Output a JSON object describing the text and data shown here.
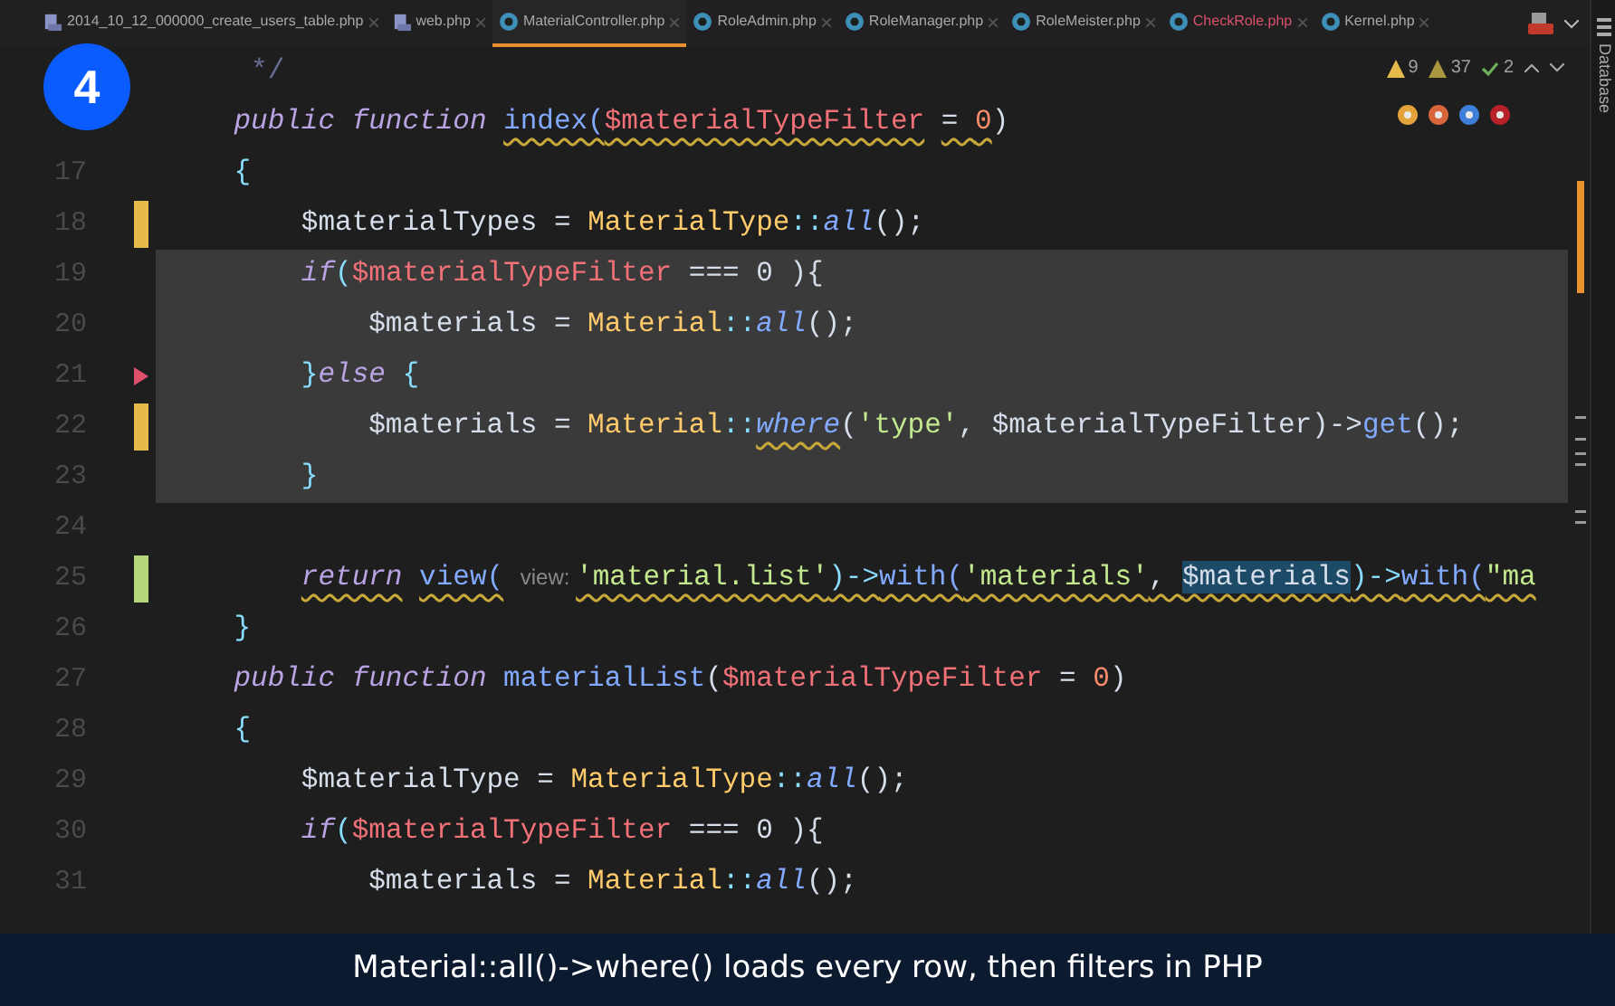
{
  "tabs": [
    {
      "label": "2014_10_12_000000_create_users_table.php",
      "kind": "database",
      "selected": false,
      "error": false
    },
    {
      "label": "web.php",
      "kind": "database",
      "selected": false,
      "error": false
    },
    {
      "label": "MaterialController.php",
      "kind": "class",
      "selected": true,
      "error": false
    },
    {
      "label": "RoleAdmin.php",
      "kind": "class",
      "selected": false,
      "error": false
    },
    {
      "label": "RoleManager.php",
      "kind": "class",
      "selected": false,
      "error": false
    },
    {
      "label": "RoleMeister.php",
      "kind": "class",
      "selected": false,
      "error": false
    },
    {
      "label": "CheckRole.php",
      "kind": "class",
      "selected": false,
      "error": true
    },
    {
      "label": "Kernel.php",
      "kind": "class",
      "selected": false,
      "error": false
    }
  ],
  "side_panel": {
    "label": "Database"
  },
  "step_badge": "4",
  "inspections": [
    {
      "kind": "warning",
      "count": "9"
    },
    {
      "kind": "weak",
      "count": "37"
    },
    {
      "kind": "typo",
      "count": "2"
    }
  ],
  "editor": {
    "lines": [
      {
        "selected": false,
        "tokens": [
          {
            "text": "     */",
            "kind": "comment"
          }
        ]
      },
      {
        "selected": false,
        "tokens": [
          {
            "text": "    public function ",
            "kind": "keyword"
          },
          {
            "text": "index(",
            "kind": "fn",
            "squiggle": true
          },
          {
            "text": "$materialTypeFilter",
            "kind": "param",
            "squiggle": true
          },
          {
            "text": " = ",
            "kind": "plain",
            "squiggle": true
          },
          {
            "text": "0",
            "kind": "number",
            "squiggle": true
          },
          {
            "text": ")",
            "kind": "plain",
            "squiggle": false
          }
        ]
      },
      {
        "number": "17",
        "selected": false,
        "tokens": [
          {
            "text": "    {",
            "kind": "punct"
          }
        ]
      },
      {
        "number": "18",
        "kind": "modified",
        "selected": false,
        "tokens": [
          {
            "text": "        $materialTypes = ",
            "kind": "plain"
          },
          {
            "text": "MaterialType",
            "kind": "class"
          },
          {
            "text": "::",
            "kind": "punct"
          },
          {
            "text": "all",
            "kind": "static"
          },
          {
            "text": "();",
            "kind": "plain"
          }
        ]
      },
      {
        "number": "19",
        "selected": true,
        "tokens": [
          {
            "text": "        if",
            "kind": "keyword"
          },
          {
            "text": "(",
            "kind": "punct"
          },
          {
            "text": "$materialTypeFilter",
            "kind": "param"
          },
          {
            "text": " === 0 ){",
            "kind": "plain"
          }
        ]
      },
      {
        "number": "20",
        "selected": true,
        "tokens": [
          {
            "text": "            $materials = ",
            "kind": "plain"
          },
          {
            "text": "Material",
            "kind": "class"
          },
          {
            "text": "::",
            "kind": "punct"
          },
          {
            "text": "all",
            "kind": "static"
          },
          {
            "text": "();",
            "kind": "plain"
          }
        ]
      },
      {
        "number": "21",
        "kind": "pointer",
        "selected": true,
        "tokens": [
          {
            "text": "        }",
            "kind": "punct"
          },
          {
            "text": "else",
            "kind": "keyword"
          },
          {
            "text": " {",
            "kind": "punct"
          }
        ]
      },
      {
        "number": "22",
        "kind": "modified",
        "selected": true,
        "tokens": [
          {
            "text": "            $materials = ",
            "kind": "plain"
          },
          {
            "text": "Material",
            "kind": "class"
          },
          {
            "text": "::",
            "kind": "punct"
          },
          {
            "text": "where",
            "kind": "static",
            "squiggle": true
          },
          {
            "text": "(",
            "kind": "plain",
            "squiggle": false
          },
          {
            "text": "'type'",
            "kind": "string"
          },
          {
            "text": ", $materialTypeFilter)->",
            "kind": "plain"
          },
          {
            "text": "get",
            "kind": "fn"
          },
          {
            "text": "();",
            "kind": "plain"
          }
        ]
      },
      {
        "number": "23",
        "selected": true,
        "tokens": [
          {
            "text": "        }",
            "kind": "punct"
          }
        ]
      },
      {
        "number": "24",
        "selected": false
      },
      {
        "number": "25",
        "kind": "added",
        "selected": false,
        "tokens": [
          {
            "text": "        return",
            "kind": "keyword",
            "squiggle": true
          },
          {
            "text": " view(",
            "kind": "fn",
            "squiggle": true
          },
          {
            "text": " view: ",
            "kind": "hint"
          },
          {
            "text": "'material.list'",
            "kind": "string",
            "squiggle": true
          },
          {
            "text": ")->",
            "kind": "punct",
            "squiggle": true
          },
          {
            "text": "with(",
            "kind": "fn",
            "squiggle": true
          },
          {
            "text": "'materials'",
            "kind": "string",
            "squiggle": true
          },
          {
            "text": ", ",
            "kind": "plain",
            "squiggle": true
          },
          {
            "text": "$materials",
            "kind": "usage",
            "squiggle": true
          },
          {
            "text": ")->",
            "kind": "punct",
            "squiggle": true
          },
          {
            "text": "with(",
            "kind": "fn",
            "squiggle": true
          },
          {
            "text": "\"ma",
            "kind": "string",
            "squiggle": true
          }
        ]
      },
      {
        "number": "26",
        "selected": false,
        "tokens": [
          {
            "text": "    }",
            "kind": "punct"
          }
        ]
      },
      {
        "number": "27",
        "selected": false,
        "tokens": [
          {
            "text": "    public function ",
            "kind": "keyword"
          },
          {
            "text": "materialList",
            "kind": "fn"
          },
          {
            "text": "(",
            "kind": "plain"
          },
          {
            "text": "$materialTypeFilter",
            "kind": "param"
          },
          {
            "text": " = ",
            "kind": "plain"
          },
          {
            "text": "0",
            "kind": "number"
          },
          {
            "text": ")",
            "kind": "plain"
          }
        ]
      },
      {
        "number": "28",
        "selected": false,
        "tokens": [
          {
            "text": "    {",
            "kind": "punct"
          }
        ]
      },
      {
        "number": "29",
        "selected": false,
        "tokens": [
          {
            "text": "        $materialType = ",
            "kind": "plain"
          },
          {
            "text": "MaterialType",
            "kind": "class"
          },
          {
            "text": "::",
            "kind": "punct"
          },
          {
            "text": "all",
            "kind": "static"
          },
          {
            "text": "();",
            "kind": "plain"
          }
        ]
      },
      {
        "number": "30",
        "selected": false,
        "tokens": [
          {
            "text": "        if",
            "kind": "keyword"
          },
          {
            "text": "(",
            "kind": "punct"
          },
          {
            "text": "$materialTypeFilter",
            "kind": "param"
          },
          {
            "text": " === 0 ){",
            "kind": "plain"
          }
        ]
      },
      {
        "number": "31",
        "selected": false,
        "tokens": [
          {
            "text": "            $materials = ",
            "kind": "plain"
          },
          {
            "text": "Material",
            "kind": "class"
          },
          {
            "text": "::",
            "kind": "punct"
          },
          {
            "text": "all",
            "kind": "static"
          },
          {
            "text": "();",
            "kind": "plain"
          }
        ]
      }
    ]
  },
  "caption": "Material::all()->where() loads every row, then filters in PHP"
}
